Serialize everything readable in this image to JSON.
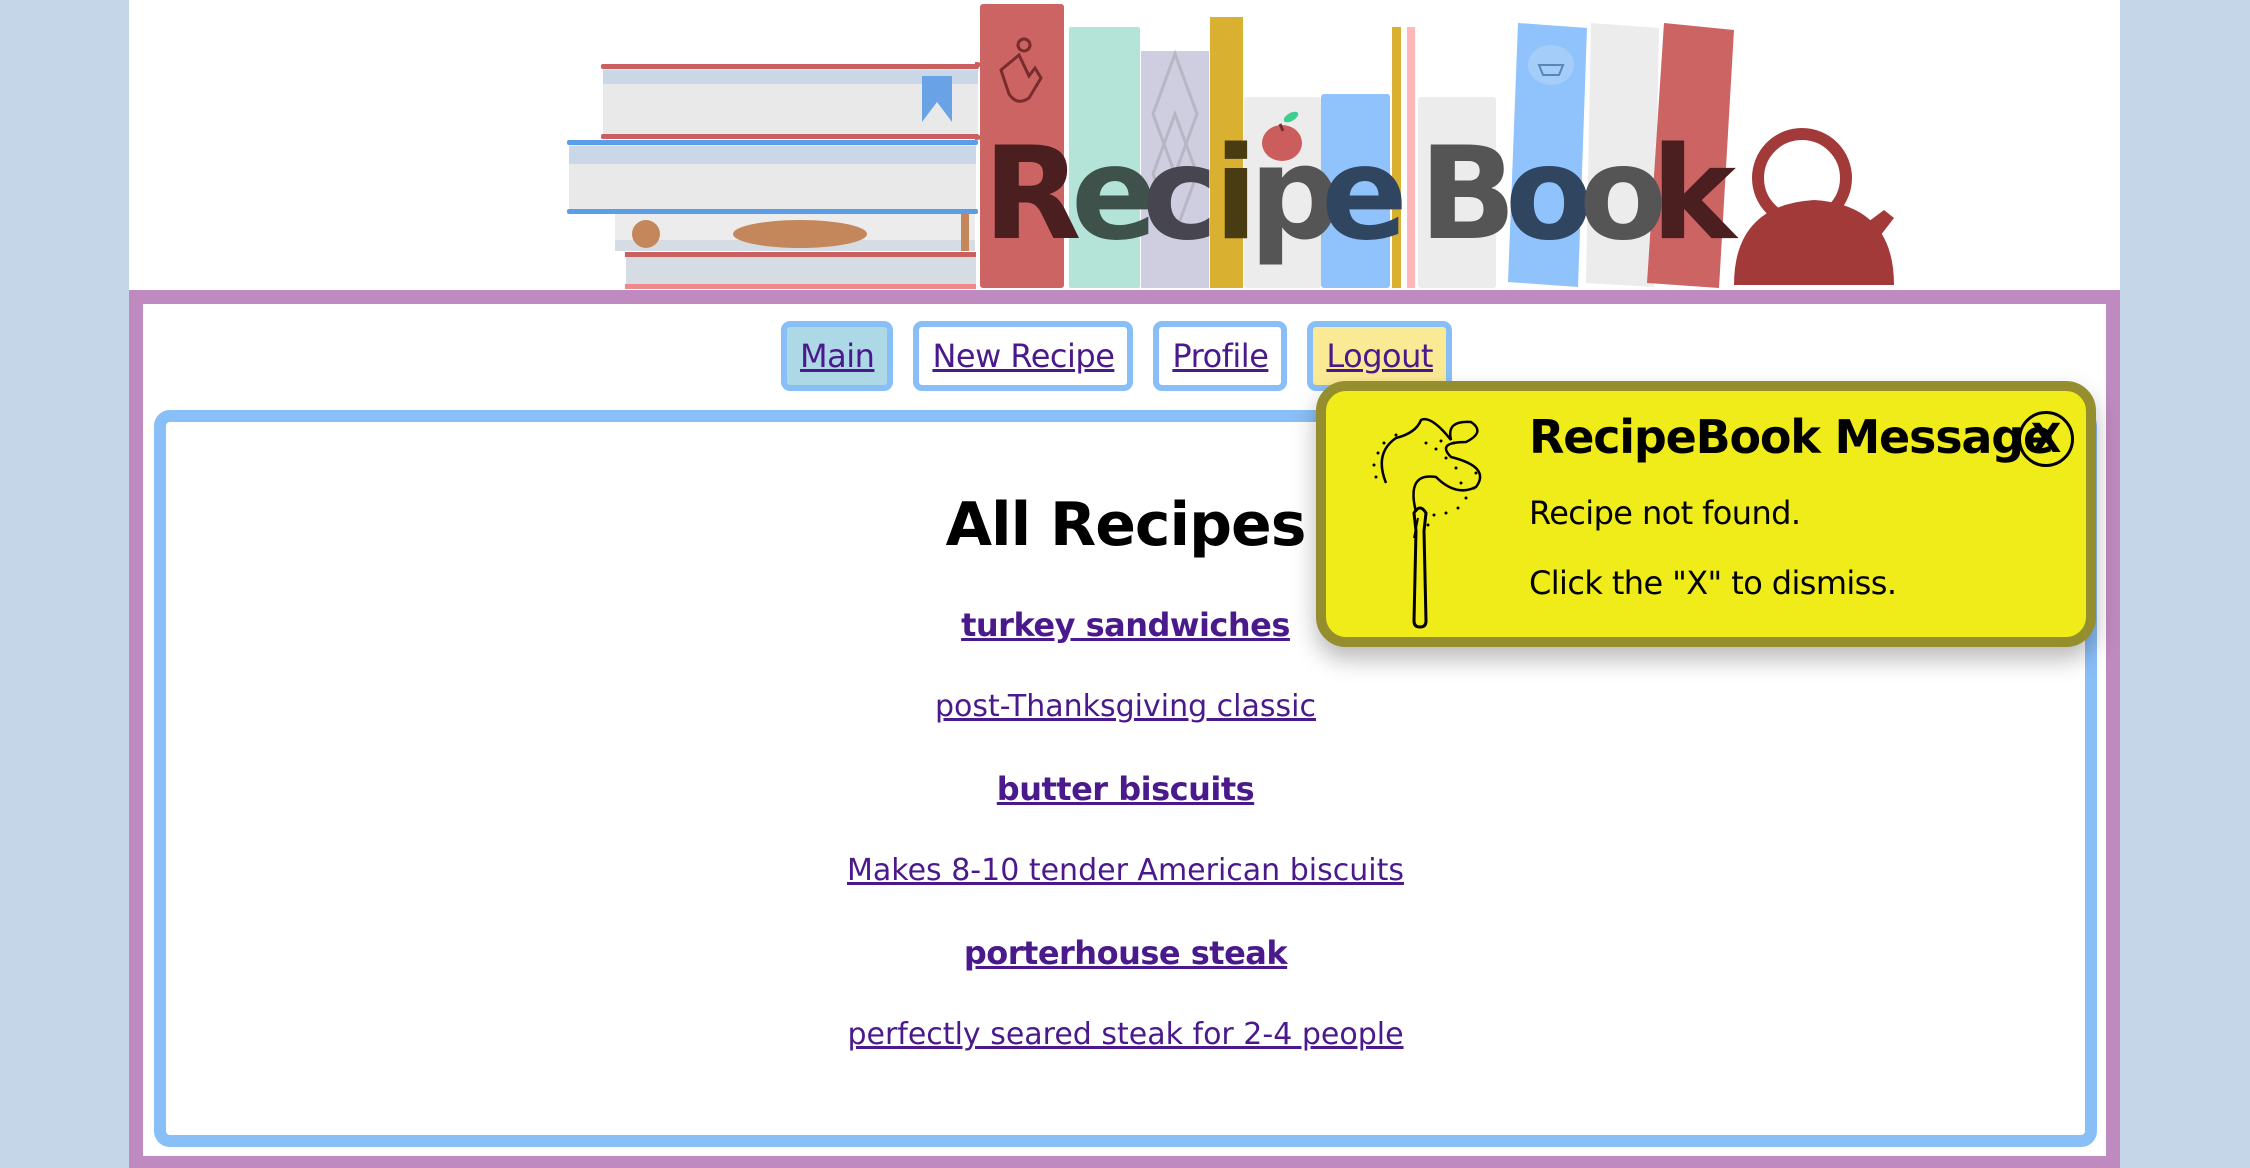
{
  "banner": {
    "logo_text_part1": "Recipe",
    "logo_text_part2": "Book",
    "logo_alt": "RecipeBook"
  },
  "nav": {
    "items": [
      {
        "label": "Main",
        "state": "active"
      },
      {
        "label": "New Recipe",
        "state": "default"
      },
      {
        "label": "Profile",
        "state": "default"
      },
      {
        "label": "Logout",
        "state": "highlight"
      }
    ]
  },
  "main": {
    "heading": "All Recipes",
    "recipes": [
      {
        "title": "turkey sandwiches",
        "description": "post-Thanksgiving classic"
      },
      {
        "title": "butter biscuits",
        "description": "Makes 8-10 tender American biscuits"
      },
      {
        "title": "porterhouse steak",
        "description": "perfectly seared steak for 2-4 people"
      }
    ]
  },
  "message": {
    "title": "RecipeBook Message",
    "lines": [
      "Recipe not found.",
      "Click the \"X\" to dismiss."
    ],
    "close_label": "X",
    "icon": "extinguished-match-icon"
  },
  "colors": {
    "page_background": "#c4d6e7",
    "frame_border": "#bf8abf",
    "card_border": "#89bff7",
    "link": "#4a1a8c",
    "nav_active_bg": "#add8e6",
    "nav_logout_bg": "#fbea95",
    "popup_bg": "#f0ec1a",
    "popup_border": "#958e2f"
  }
}
